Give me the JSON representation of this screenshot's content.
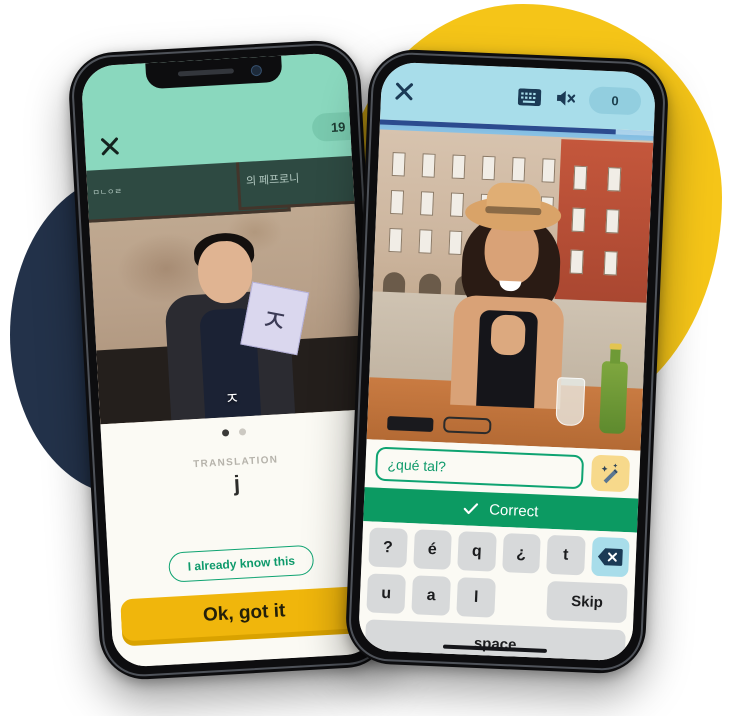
{
  "left_phone": {
    "header": {
      "close_icon": "close-icon",
      "counter": "19"
    },
    "media": {
      "subtitle": "ㅈ",
      "flashcard_character": "ㅈ",
      "board_text_1": "ㅁㄴㅇㄹ",
      "board_text_2": "의 페프로니"
    },
    "card": {
      "label": "TRANSLATION",
      "value": "j",
      "know_button": "I already know this",
      "cta_button": "Ok, got it",
      "dots": [
        true,
        false
      ]
    }
  },
  "right_phone": {
    "header": {
      "close_icon": "close-icon",
      "keyboard_icon": "keyboard-icon",
      "mute_icon": "speaker-mute-icon",
      "score": "0"
    },
    "progress_percent": 86,
    "answer": {
      "value": "¿qué tal?",
      "placeholder": "¿qué tal?",
      "hint_icon": "magic-wand-icon"
    },
    "feedback": {
      "icon": "check-icon",
      "text": "Correct"
    },
    "keyboard": {
      "row1": [
        "?",
        "é",
        "q",
        "¿",
        "t"
      ],
      "backspace_icon": "backspace-icon",
      "row2": [
        "u",
        "a",
        "l"
      ],
      "skip_label": "Skip",
      "space_label": "space"
    }
  },
  "colors": {
    "yellow_blob": "#F5C518",
    "navy_blob": "#23324A",
    "left_header_mint": "#8AD8BE",
    "right_header_blue": "#A8DDEA",
    "correct_green": "#0C9A62",
    "cta_yellow": "#F0B60C",
    "progress_navy": "#2B4B8F"
  }
}
